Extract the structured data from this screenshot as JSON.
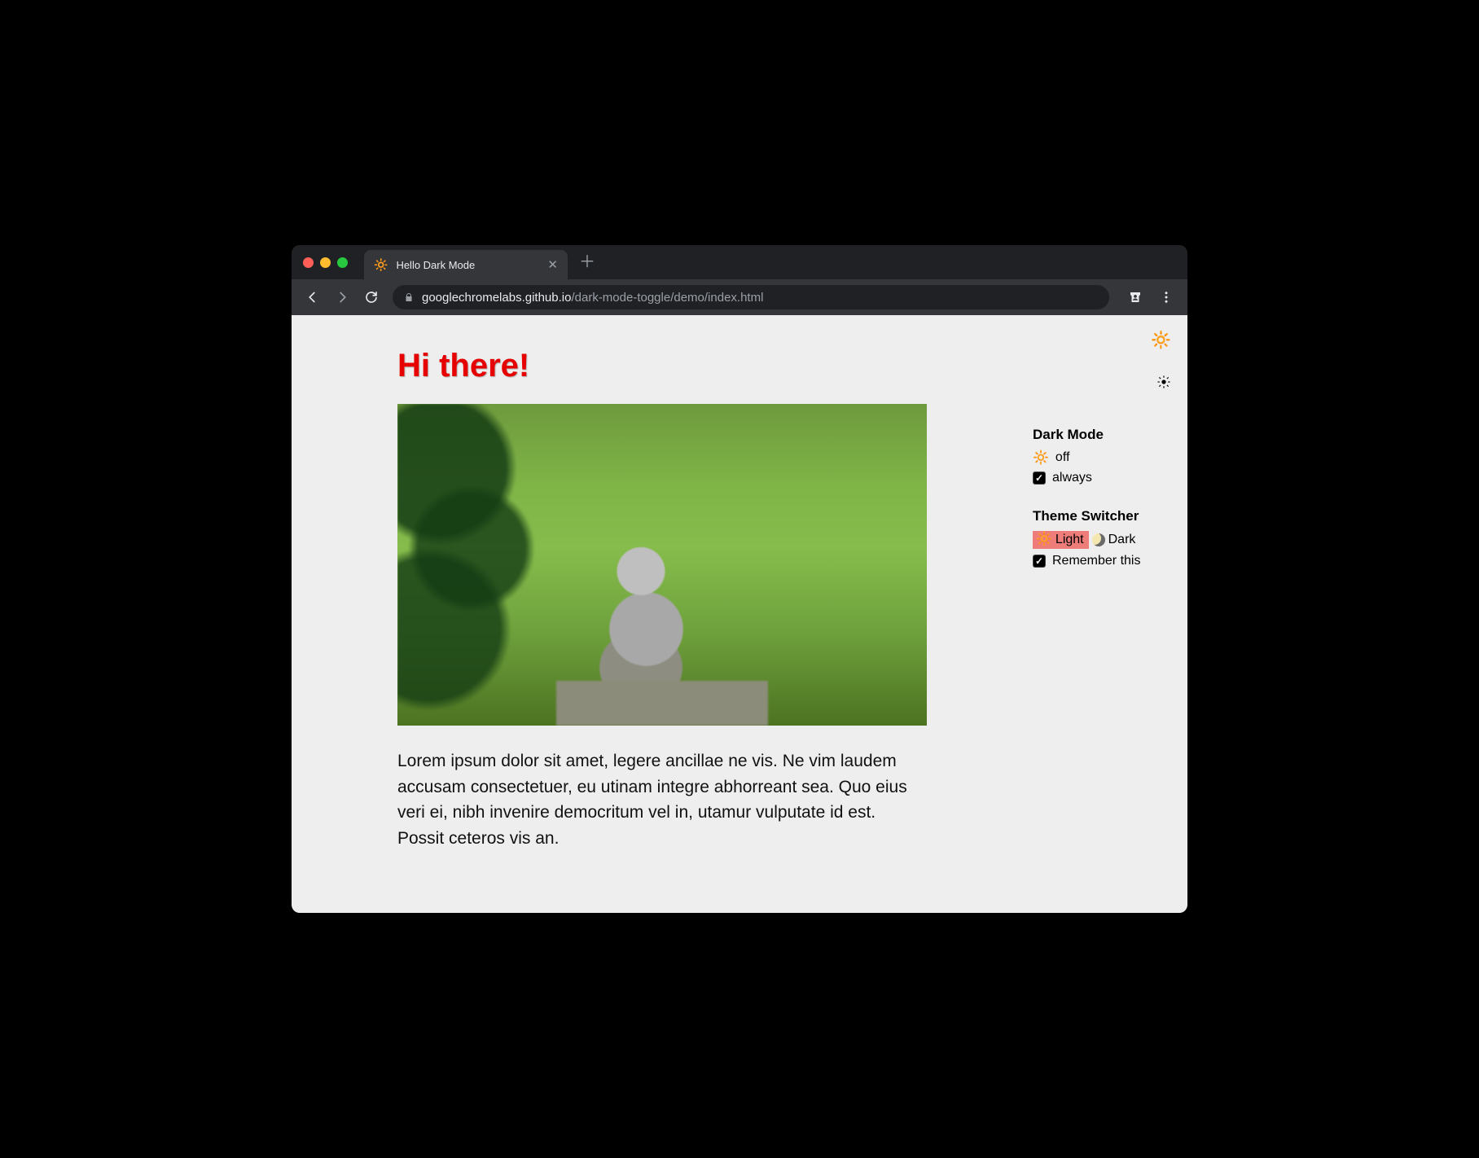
{
  "browser": {
    "tab": {
      "favicon": "🔆",
      "title": "Hello Dark Mode"
    },
    "url_host": "googlechromelabs.github.io",
    "url_path": "/dark-mode-toggle/demo/index.html"
  },
  "page": {
    "heading": "Hi there!",
    "paragraph": "Lorem ipsum dolor sit amet, legere ancillae ne vis. Ne vim laudem accusam consectetuer, eu utinam integre abhorreant sea. Quo eius veri ei, nibh invenire democritum vel in, utamur vulputate id est. Possit ceteros vis an."
  },
  "aside": {
    "top_emoji": "🔆",
    "darkmode": {
      "title": "Dark Mode",
      "state_icon": "🔆",
      "state_label": "off",
      "always_label": "always",
      "always_checked": true
    },
    "switcher": {
      "title": "Theme Switcher",
      "light_icon": "🔆",
      "light_label": "Light",
      "dark_label": "Dark",
      "active": "light",
      "remember_label": "Remember this",
      "remember_checked": true
    }
  }
}
